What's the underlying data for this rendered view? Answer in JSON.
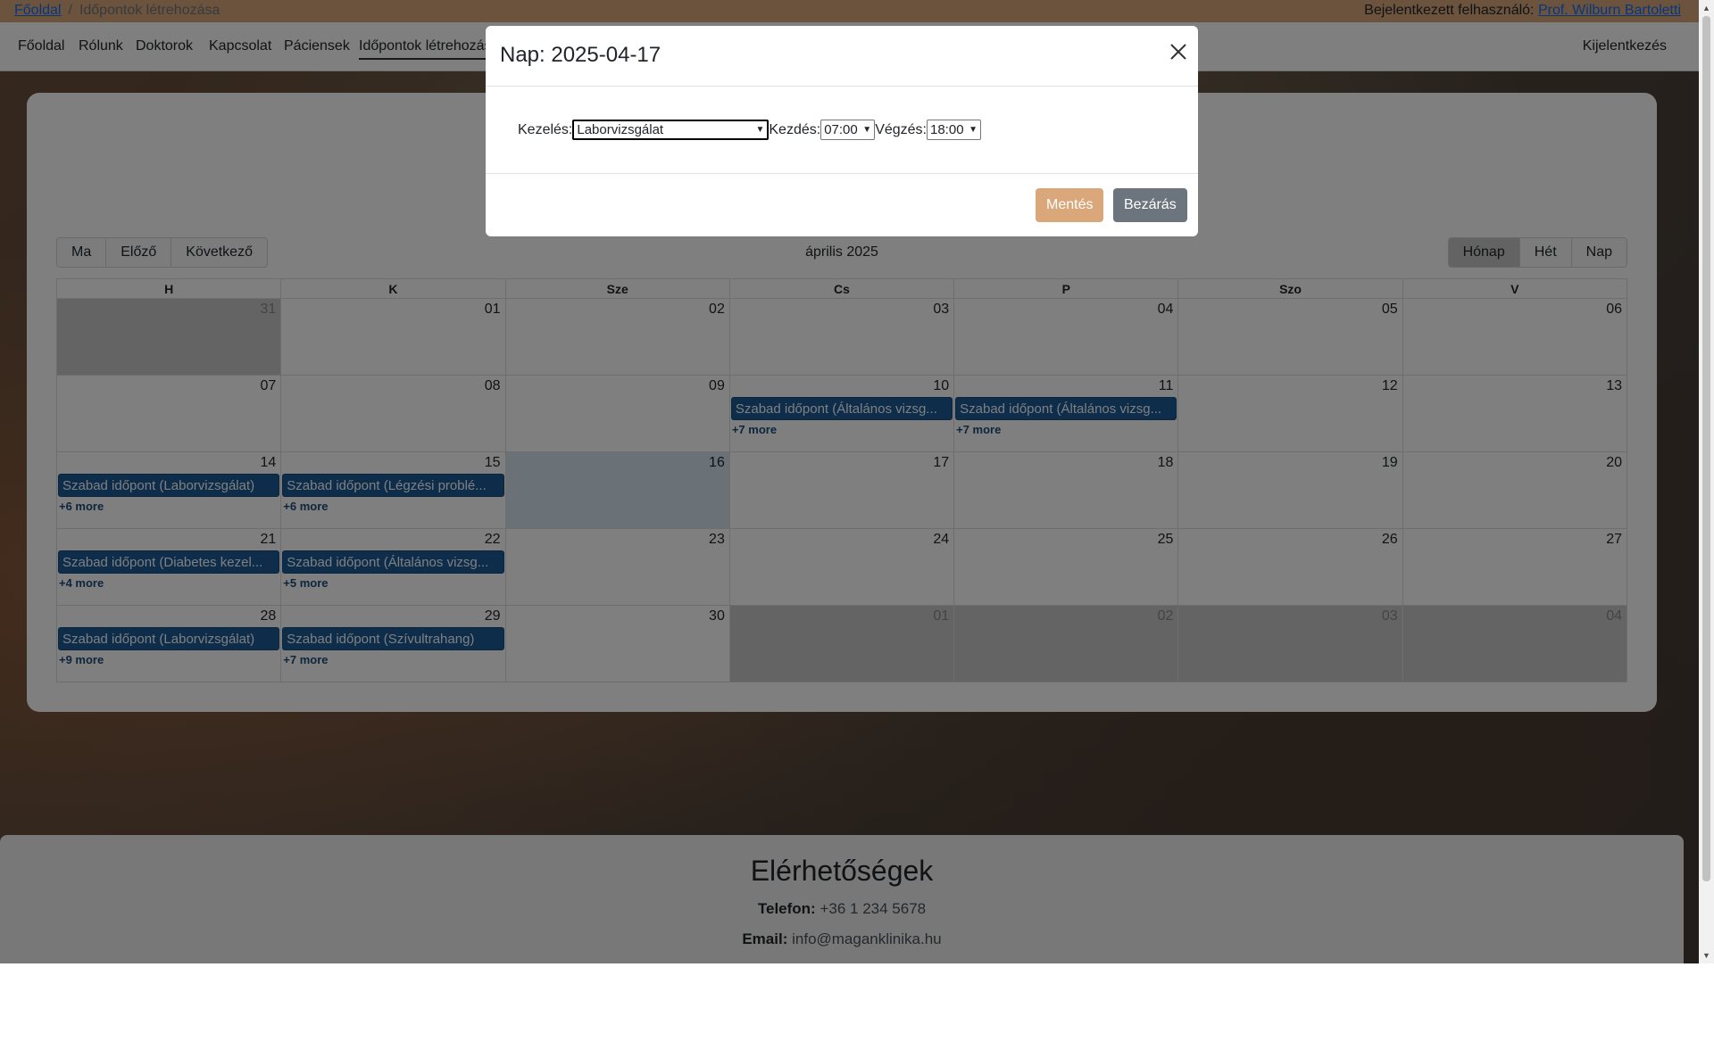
{
  "breadcrumb": {
    "home": "Főoldal",
    "separator": "/",
    "current": "Időpontok létrehozása"
  },
  "user": {
    "prefix": "Bejelentkezett felhasználó:",
    "name": "Prof. Wilburn Bartoletti"
  },
  "nav": {
    "items": [
      "Főoldal",
      "Rólunk",
      "Doktorok",
      "Kapcsolat",
      "Páciensek",
      "Időpontok létrehozása"
    ],
    "logout": "Kijelentkezés"
  },
  "toolbar": {
    "today": "Ma",
    "prev": "Előző",
    "next": "Következő",
    "title": "április 2025",
    "month": "Hónap",
    "week": "Hét",
    "day": "Nap"
  },
  "calendar": {
    "weekdays": [
      "H",
      "K",
      "Sze",
      "Cs",
      "P",
      "Szo",
      "V"
    ],
    "weeks": [
      [
        {
          "d": "31",
          "t": "other"
        },
        {
          "d": "01"
        },
        {
          "d": "02"
        },
        {
          "d": "03"
        },
        {
          "d": "04"
        },
        {
          "d": "05"
        },
        {
          "d": "06"
        }
      ],
      [
        {
          "d": "07"
        },
        {
          "d": "08"
        },
        {
          "d": "09"
        },
        {
          "d": "10",
          "ev": "Szabad időpont (Általános vizsg...",
          "more": "+7 more"
        },
        {
          "d": "11",
          "ev": "Szabad időpont (Általános vizsg...",
          "more": "+7 more"
        },
        {
          "d": "12"
        },
        {
          "d": "13"
        }
      ],
      [
        {
          "d": "14",
          "ev": "Szabad időpont (Laborvizsgálat)",
          "more": "+6 more"
        },
        {
          "d": "15",
          "ev": "Szabad időpont (Légzési problé...",
          "more": "+6 more"
        },
        {
          "d": "16",
          "t": "today"
        },
        {
          "d": "17"
        },
        {
          "d": "18"
        },
        {
          "d": "19"
        },
        {
          "d": "20"
        }
      ],
      [
        {
          "d": "21",
          "ev": "Szabad időpont (Diabetes kezel...",
          "more": "+4 more"
        },
        {
          "d": "22",
          "ev": "Szabad időpont (Általános vizsg...",
          "more": "+5 more"
        },
        {
          "d": "23"
        },
        {
          "d": "24"
        },
        {
          "d": "25"
        },
        {
          "d": "26"
        },
        {
          "d": "27"
        }
      ],
      [
        {
          "d": "28",
          "ev": "Szabad időpont (Laborvizsgálat)",
          "more": "+9 more"
        },
        {
          "d": "29",
          "ev": "Szabad időpont (Szívultrahang)",
          "more": "+7 more"
        },
        {
          "d": "30"
        },
        {
          "d": "01",
          "t": "other"
        },
        {
          "d": "02",
          "t": "other"
        },
        {
          "d": "03",
          "t": "other"
        },
        {
          "d": "04",
          "t": "other"
        }
      ]
    ]
  },
  "contact": {
    "title": "Elérhetőségek",
    "phone_label": "Telefon:",
    "phone": "+36 1 234 5678",
    "email_label": "Email:",
    "email": "info@maganklinika.hu"
  },
  "modal": {
    "title": "Nap: 2025-04-17",
    "treatment_label": "Kezelés:",
    "treatment_value": "Laborvizsgálat",
    "start_label": "Kezdés:",
    "start_value": "07:00",
    "end_label": "Végzés:",
    "end_value": "18:00",
    "save": "Mentés",
    "close": "Bezárás"
  },
  "icons": {
    "close": "close-icon",
    "dropdown": "chevron-down-icon"
  },
  "colors": {
    "accent": "#d9a77a",
    "event": "#1a5a96",
    "secondary": "#6c757d"
  }
}
